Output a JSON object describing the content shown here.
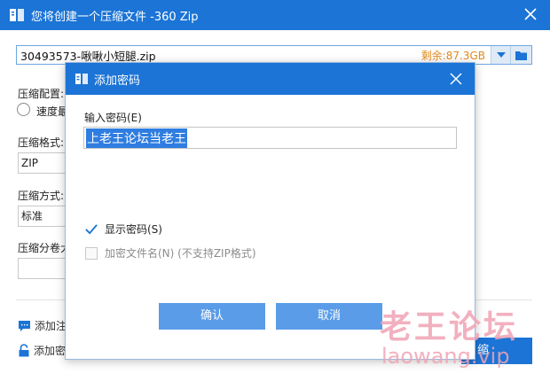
{
  "window": {
    "title": "您将创建一个压缩文件 -360 Zip",
    "title_color": "#1b74d6"
  },
  "path": {
    "filename": "30493573-啾啾小短腿.zip",
    "free_space": "剩余:87.3GB"
  },
  "settings": {
    "compress_config_label": "压缩配置:",
    "speed_radio_label": "速度最",
    "format_label": "压缩格式:",
    "format_value": "ZIP",
    "method_label": "压缩方式:",
    "method_value": "标准",
    "split_label": "压缩分卷大",
    "split_value": ""
  },
  "links": {
    "add_comment": "添加注",
    "add_password": "添加密"
  },
  "bottom_button_label": "缩",
  "dialog": {
    "title": "添加密码",
    "password_label": "输入密码(E)",
    "password_value": "上老王论坛当老王",
    "show_password_label": "显示密码(S)",
    "show_password_checked": true,
    "encrypt_names_label": "加密文件名(N) (不支持ZIP格式)",
    "encrypt_names_checked": false,
    "ok_label": "确认",
    "cancel_label": "取消"
  },
  "watermark": {
    "line1": "老王论坛",
    "line2": "laowang.vip"
  }
}
